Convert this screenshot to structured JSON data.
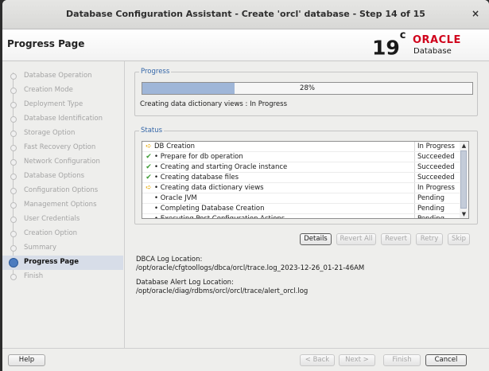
{
  "window": {
    "title": "Database Configuration Assistant - Create 'orcl' database - Step 14 of 15",
    "close_glyph": "×"
  },
  "header": {
    "page_title": "Progress Page",
    "logo": {
      "version": "19",
      "version_suffix": "c",
      "brand": "ORACLE",
      "product": "Database"
    }
  },
  "sidebar": {
    "steps": [
      {
        "label": "Database Operation",
        "state": "done"
      },
      {
        "label": "Creation Mode",
        "state": "done"
      },
      {
        "label": "Deployment Type",
        "state": "done"
      },
      {
        "label": "Database Identification",
        "state": "done"
      },
      {
        "label": "Storage Option",
        "state": "done"
      },
      {
        "label": "Fast Recovery Option",
        "state": "done"
      },
      {
        "label": "Network Configuration",
        "state": "done"
      },
      {
        "label": "Database Options",
        "state": "done"
      },
      {
        "label": "Configuration Options",
        "state": "done"
      },
      {
        "label": "Management Options",
        "state": "done"
      },
      {
        "label": "User Credentials",
        "state": "done"
      },
      {
        "label": "Creation Option",
        "state": "done"
      },
      {
        "label": "Summary",
        "state": "done"
      },
      {
        "label": "Progress Page",
        "state": "current"
      },
      {
        "label": "Finish",
        "state": "pending"
      }
    ]
  },
  "progress": {
    "group_title": "Progress",
    "fraction": 0.28,
    "percent_text": "28%",
    "message": "Creating data dictionary views : In Progress"
  },
  "status": {
    "group_title": "Status",
    "rows": [
      {
        "icon": "arrow-icon",
        "glyph": "➪",
        "name": "DB Creation",
        "status": "In Progress"
      },
      {
        "icon": "check-icon",
        "glyph": "✔",
        "name": "• Prepare for db operation",
        "status": "Succeeded"
      },
      {
        "icon": "check-icon",
        "glyph": "✔",
        "name": "• Creating and starting Oracle instance",
        "status": "Succeeded"
      },
      {
        "icon": "check-icon",
        "glyph": "✔",
        "name": "• Creating database files",
        "status": "Succeeded"
      },
      {
        "icon": "arrow-icon",
        "glyph": "➪",
        "name": "• Creating data dictionary views",
        "status": "In Progress"
      },
      {
        "icon": "",
        "glyph": "",
        "name": "• Oracle JVM",
        "status": "Pending"
      },
      {
        "icon": "",
        "glyph": "",
        "name": "• Completing Database Creation",
        "status": "Pending"
      },
      {
        "icon": "",
        "glyph": "",
        "name": "• Executing Post Configuration Actions",
        "status": "Pending"
      }
    ]
  },
  "actions": {
    "details": "Details",
    "revert_all": "Revert All",
    "revert": "Revert",
    "retry": "Retry",
    "skip": "Skip"
  },
  "logs": {
    "dbca_label": "DBCA Log Location:",
    "dbca_path": "/opt/oracle/cfgtoollogs/dbca/orcl/trace.log_2023-12-26_01-21-46AM",
    "alert_label": "Database Alert Log Location:",
    "alert_path": "/opt/oracle/diag/rdbms/orcl/orcl/trace/alert_orcl.log"
  },
  "footer": {
    "help": "Help",
    "back": "< Back",
    "next": "Next >",
    "finish": "Finish",
    "cancel": "Cancel"
  }
}
